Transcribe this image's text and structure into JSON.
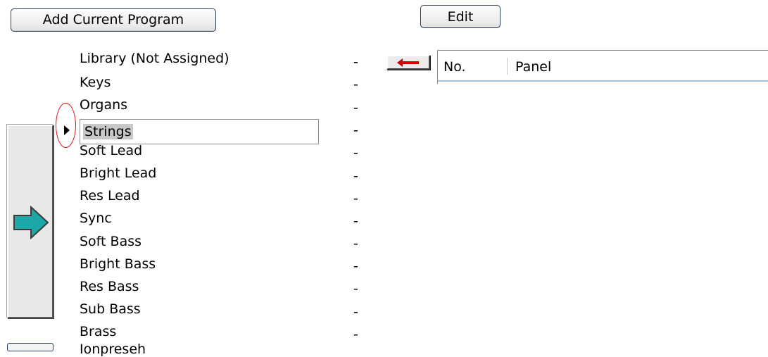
{
  "toolbar": {
    "add_current_program_label": "Add Current Program",
    "edit_label": "Edit"
  },
  "library": {
    "items": [
      {
        "label": "Library (Not Assigned)",
        "value": "-"
      },
      {
        "label": "Keys",
        "value": "-"
      },
      {
        "label": "Organs",
        "value": "-"
      },
      {
        "label": "Strings",
        "value": "-",
        "selected": true
      },
      {
        "label": "Soft Lead",
        "value": "-"
      },
      {
        "label": "Bright Lead",
        "value": "-"
      },
      {
        "label": "Res Lead",
        "value": "-"
      },
      {
        "label": "Sync",
        "value": "-"
      },
      {
        "label": "Soft Bass",
        "value": "-"
      },
      {
        "label": "Bright Bass",
        "value": "-"
      },
      {
        "label": "Res Bass",
        "value": "-"
      },
      {
        "label": "Sub Bass",
        "value": "-"
      },
      {
        "label": "Brass",
        "value": "-"
      }
    ],
    "partial_next_item": "Ionpreseh"
  },
  "panel_table": {
    "columns": [
      "No.",
      "Panel"
    ]
  },
  "icons": {
    "assign_button": "right-arrow-icon",
    "remove_button": "left-arrow-icon",
    "selection_marker": "play-triangle-icon",
    "highlight": "red-ellipse-annotation"
  },
  "colors": {
    "arrow_teal": "#1aa8a8",
    "arrow_red": "#d40000",
    "selection_bg": "#c8c8c8",
    "annotation_red": "#e01010"
  }
}
